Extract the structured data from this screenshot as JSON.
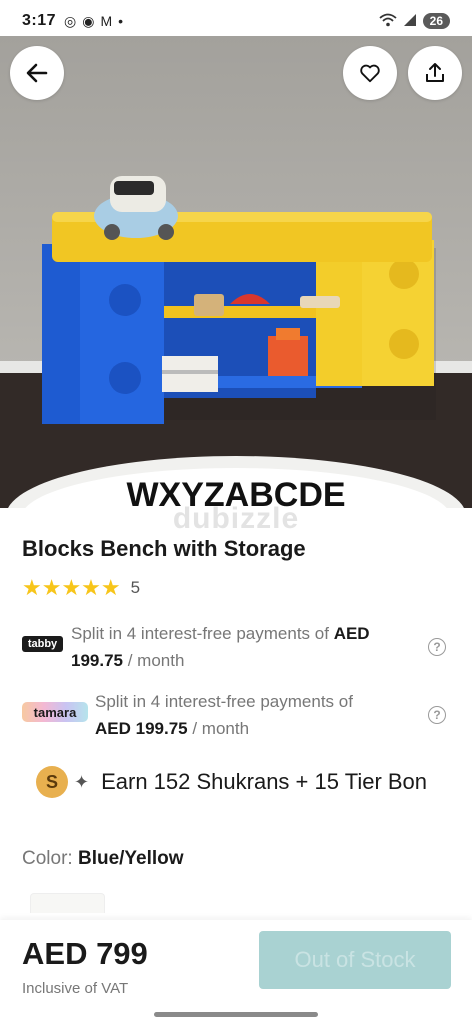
{
  "status_bar": {
    "time": "3:17",
    "battery": "26",
    "left_icons": [
      "whatsapp-icon",
      "chat-icon",
      "gmail-icon",
      "dot-icon"
    ],
    "right_icons": [
      "wifi-icon",
      "signal-icon",
      "battery-icon"
    ]
  },
  "hero": {
    "rug_text": "WXYZABCDE"
  },
  "watermark": "dubizzle",
  "product": {
    "title": "Blocks Bench with Storage",
    "stars": "★★★★★",
    "rating_count": "5"
  },
  "tabby": {
    "logo": "tabby",
    "text_prefix": "Split in 4 interest-free payments of ",
    "amount": "AED 199.75",
    "suffix": " / month"
  },
  "tamara": {
    "logo": "tamara",
    "text_prefix": "Split in 4 interest-free payments of",
    "amount": "AED 199.75",
    "suffix": " / month"
  },
  "shukran": {
    "badge": "S",
    "text": "Earn 152 Shukrans + 15 Tier Bon"
  },
  "color": {
    "label": "Color: ",
    "value": "Blue/Yellow"
  },
  "footer": {
    "price": "AED 799",
    "vat_note": "Inclusive of VAT",
    "button": "Out of Stock"
  },
  "colors": {
    "accent_teal": "#a9d2d2",
    "star": "#f7c51a",
    "bench_blue": "#1f5fd6",
    "bench_yellow": "#f3cd2a"
  }
}
